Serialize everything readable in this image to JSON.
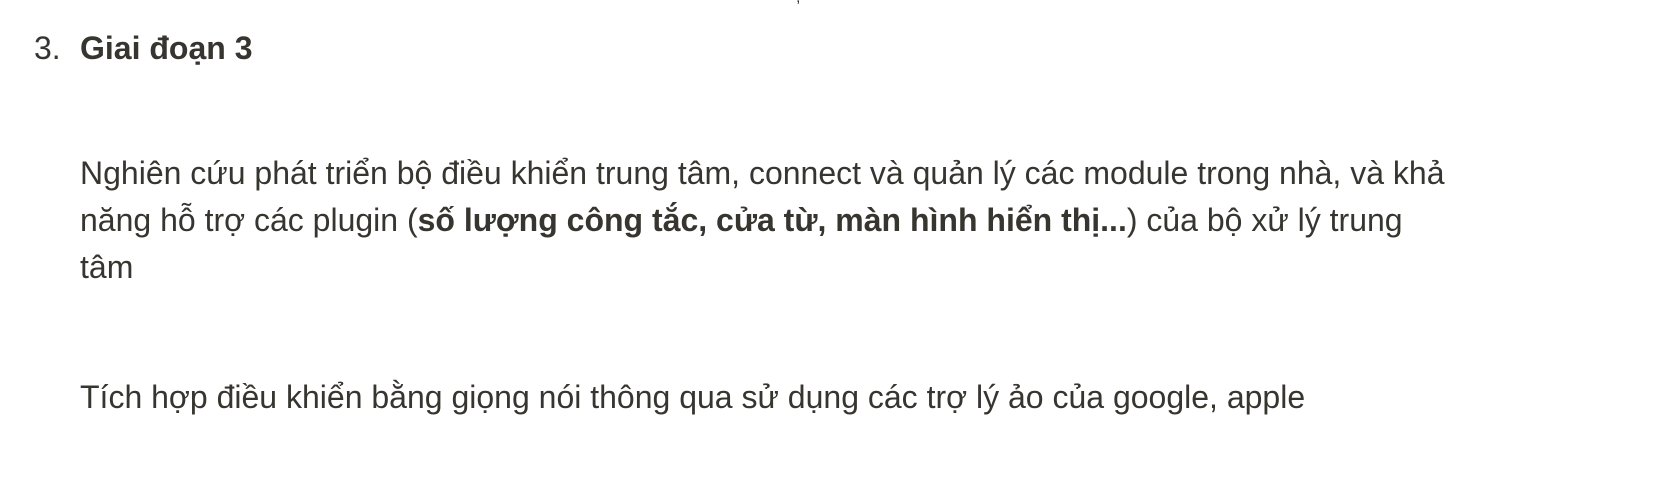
{
  "list": {
    "number": "3.",
    "heading": "Giai đoạn 3"
  },
  "paragraphs": [
    {
      "before": "Nghiên cứu phát triển bộ điều khiển trung tâm, connect và quản lý các module trong nhà, và khả năng hỗ trợ các plugin (",
      "bold": "số lượng công tắc, cửa từ, màn hình hiển thị...",
      "after": ") của bộ xử lý trung tâm"
    },
    {
      "text": "Tích hợp điều khiển bằng giọng nói thông qua sử dụng các trợ lý ảo của google, apple"
    }
  ]
}
